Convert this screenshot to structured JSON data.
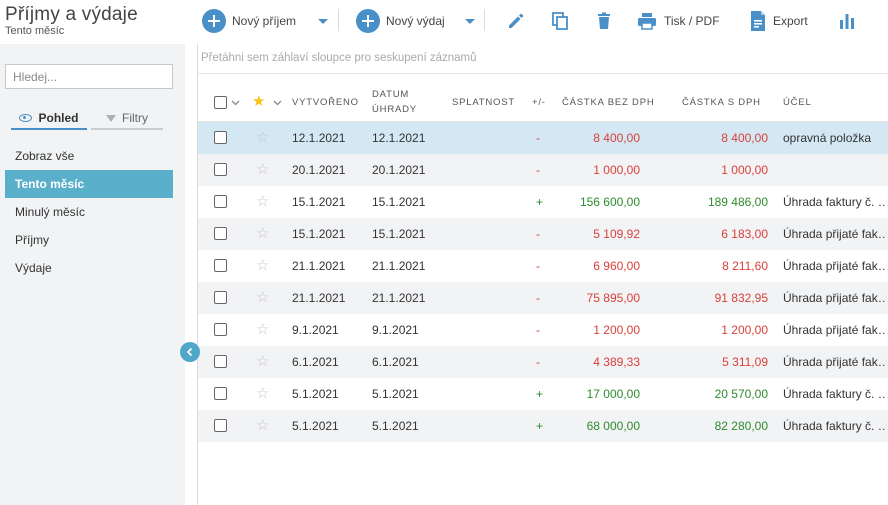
{
  "app": {
    "title": "Příjmy a výdaje",
    "subtitle": "Tento měsíc"
  },
  "toolbar": {
    "new_income": "Nový příjem",
    "new_expense": "Nový výdaj",
    "print": "Tisk / PDF",
    "export": "Export",
    "icons": [
      "plus-circle-icon",
      "chevron-down-icon",
      "pencil-icon",
      "copy-icon",
      "trash-icon",
      "printer-icon",
      "document-export-icon",
      "bar-chart-icon"
    ]
  },
  "sidebar": {
    "search_placeholder": "Hledej...",
    "view_tab": "Pohled",
    "filter_tab": "Filtry",
    "items": [
      {
        "label": "Zobraz vše"
      },
      {
        "label": "Tento měsíc"
      },
      {
        "label": "Minulý měsíc"
      },
      {
        "label": "Příjmy"
      },
      {
        "label": "Výdaje"
      }
    ]
  },
  "grid": {
    "group_hint": "Přetáhni sem záhlaví sloupce pro seskupení záznamů",
    "columns": {
      "created": "VYTVOŘENO",
      "paid_date_1": "DATUM",
      "paid_date_2": "ÚHRADY",
      "due": "SPLATNOST",
      "sign": "+/-",
      "net": "ČÁSTKA BEZ DPH",
      "gross": "ČÁSTKA S DPH",
      "purpose": "ÚČEL"
    },
    "rows": [
      {
        "created": "12.1.2021",
        "paid": "12.1.2021",
        "due": "",
        "sign": "-",
        "net": "8 400,00",
        "gross": "8 400,00",
        "purpose": "opravná položka"
      },
      {
        "created": "20.1.2021",
        "paid": "20.1.2021",
        "due": "",
        "sign": "-",
        "net": "1 000,00",
        "gross": "1 000,00",
        "purpose": ""
      },
      {
        "created": "15.1.2021",
        "paid": "15.1.2021",
        "due": "",
        "sign": "+",
        "net": "156 600,00",
        "gross": "189 486,00",
        "purpose": "Úhrada faktury č. …"
      },
      {
        "created": "15.1.2021",
        "paid": "15.1.2021",
        "due": "",
        "sign": "-",
        "net": "5 109,92",
        "gross": "6 183,00",
        "purpose": "Úhrada přijaté fak…"
      },
      {
        "created": "21.1.2021",
        "paid": "21.1.2021",
        "due": "",
        "sign": "-",
        "net": "6 960,00",
        "gross": "8 211,60",
        "purpose": "Úhrada přijaté fak…"
      },
      {
        "created": "21.1.2021",
        "paid": "21.1.2021",
        "due": "",
        "sign": "-",
        "net": "75 895,00",
        "gross": "91 832,95",
        "purpose": "Úhrada přijaté fak…"
      },
      {
        "created": "9.1.2021",
        "paid": "9.1.2021",
        "due": "",
        "sign": "-",
        "net": "1 200,00",
        "gross": "1 200,00",
        "purpose": "Úhrada přijaté fak…"
      },
      {
        "created": "6.1.2021",
        "paid": "6.1.2021",
        "due": "",
        "sign": "-",
        "net": "4 389,33",
        "gross": "5 311,09",
        "purpose": "Úhrada přijaté fak…"
      },
      {
        "created": "5.1.2021",
        "paid": "5.1.2021",
        "due": "",
        "sign": "+",
        "net": "17 000,00",
        "gross": "20 570,00",
        "purpose": "Úhrada faktury č. …"
      },
      {
        "created": "5.1.2021",
        "paid": "5.1.2021",
        "due": "",
        "sign": "+",
        "net": "68 000,00",
        "gross": "82 280,00",
        "purpose": "Úhrada faktury č. …"
      }
    ]
  },
  "colors": {
    "accent": "#4a90c8",
    "active_nav": "#5ab0cb",
    "selected_row": "#d4e8f3",
    "negative": "#d9403a",
    "positive": "#2e8b2e",
    "star_active": "#f5c518"
  }
}
